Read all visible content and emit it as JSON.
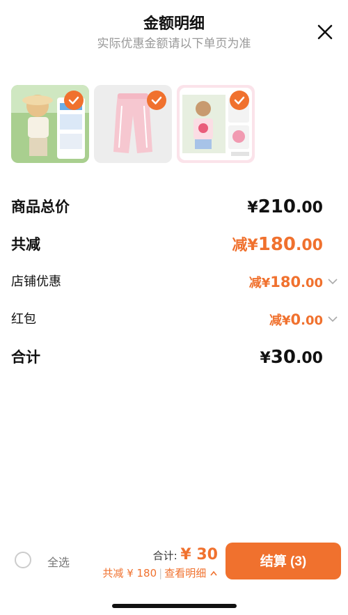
{
  "header": {
    "title": "金额明细",
    "subtitle": "实际优惠金额请以下单页为准"
  },
  "products": [
    {
      "name": "kids-tshirt-shorts",
      "selected": true
    },
    {
      "name": "pink-pants",
      "selected": true
    },
    {
      "name": "strawberry-tshirt",
      "selected": true
    }
  ],
  "details": {
    "goods_total": {
      "label": "商品总价",
      "currency": "¥",
      "int": "210",
      "dec": ".00"
    },
    "total_reduce": {
      "label": "共减",
      "prefix": "减",
      "currency": "¥",
      "int": "180",
      "dec": ".00"
    },
    "store_discount": {
      "label": "店铺优惠",
      "prefix": "减",
      "currency": "¥",
      "int": "180",
      "dec": ".00"
    },
    "red_packet": {
      "label": "红包",
      "prefix": "减",
      "currency": "¥",
      "int": "0",
      "dec": ".00"
    },
    "sum": {
      "label": "合计",
      "currency": "¥",
      "int": "30",
      "dec": ".00"
    }
  },
  "footer": {
    "select_all": "全选",
    "total_label": "合计:",
    "total_value": "¥ 30",
    "reduce_text": "共减 ¥ 180",
    "view_detail": "查看明细",
    "checkout": "结算 (3)"
  },
  "colors": {
    "accent": "#f0712e"
  }
}
